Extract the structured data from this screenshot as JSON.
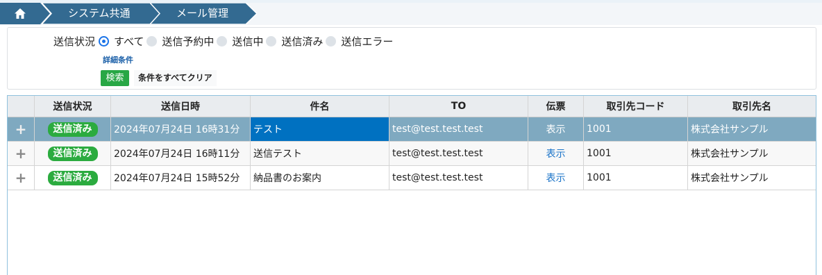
{
  "breadcrumb": {
    "home_icon": "home-icon",
    "items": [
      {
        "label": "システム共通"
      },
      {
        "label": "メール管理"
      }
    ],
    "color": "#336a91"
  },
  "search": {
    "status_label": "送信状況",
    "options": [
      {
        "label": "すべて",
        "checked": true
      },
      {
        "label": "送信予約中",
        "checked": false
      },
      {
        "label": "送信中",
        "checked": false
      },
      {
        "label": "送信済み",
        "checked": false
      },
      {
        "label": "送信エラー",
        "checked": false
      }
    ],
    "detail_link": "詳細条件",
    "search_button": "検索",
    "clear_button": "条件をすべてクリア"
  },
  "grid": {
    "columns": [
      "送信状況",
      "送信日時",
      "件名",
      "TO",
      "伝票",
      "取引先コード",
      "取引先名"
    ],
    "expand_icon": "plus-icon",
    "rows": [
      {
        "expand": "+",
        "status": "送信済み",
        "datetime": "2024年07月24日 16時31分",
        "subject": "テスト",
        "to": "test@test.test.test",
        "slip": "表示",
        "code": "1001",
        "name": "株式会社サンプル",
        "selected": true
      },
      {
        "expand": "+",
        "status": "送信済み",
        "datetime": "2024年07月24日 16時11分",
        "subject": "送信テスト",
        "to": "test@test.test.test",
        "slip": "表示",
        "code": "1001",
        "name": "株式会社サンプル",
        "selected": false
      },
      {
        "expand": "+",
        "status": "送信済み",
        "datetime": "2024年07月24日 15時52分",
        "subject": "納品書のお案内",
        "to": "test@test.test.test",
        "slip": "表示",
        "code": "1001",
        "name": "株式会社サンプル",
        "selected": false
      }
    ]
  }
}
